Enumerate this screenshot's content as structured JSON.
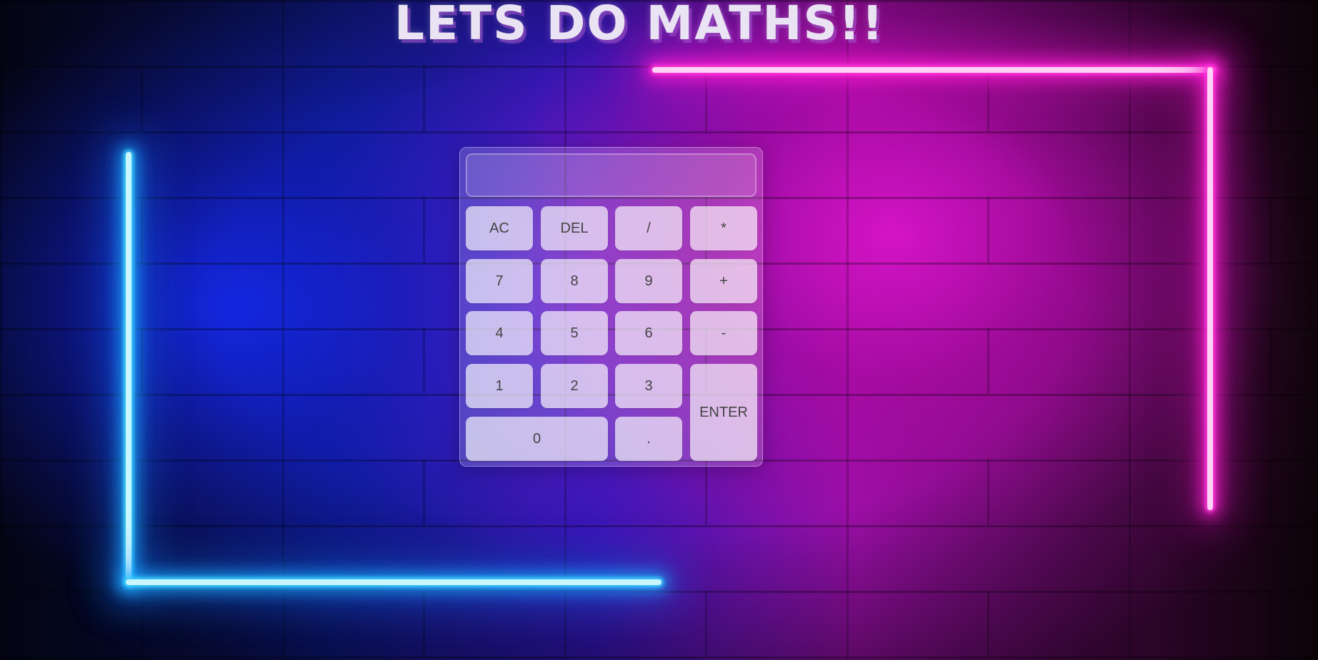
{
  "page": {
    "heading": "LETS DO MATHS!!"
  },
  "calculator": {
    "display_value": "",
    "buttons": {
      "ac": "AC",
      "del": "DEL",
      "divide": "/",
      "multiply": "*",
      "seven": "7",
      "eight": "8",
      "nine": "9",
      "plus": "+",
      "four": "4",
      "five": "5",
      "six": "6",
      "minus": "-",
      "one": "1",
      "two": "2",
      "three": "3",
      "enter": "ENTER",
      "zero": "0",
      "decimal": "."
    }
  },
  "colors": {
    "neon_left": "#3fd4ff",
    "neon_right": "#ff3ad9",
    "background_blue": "#1a2ee6",
    "background_magenta": "#d714c8",
    "button_text": "#444444"
  }
}
